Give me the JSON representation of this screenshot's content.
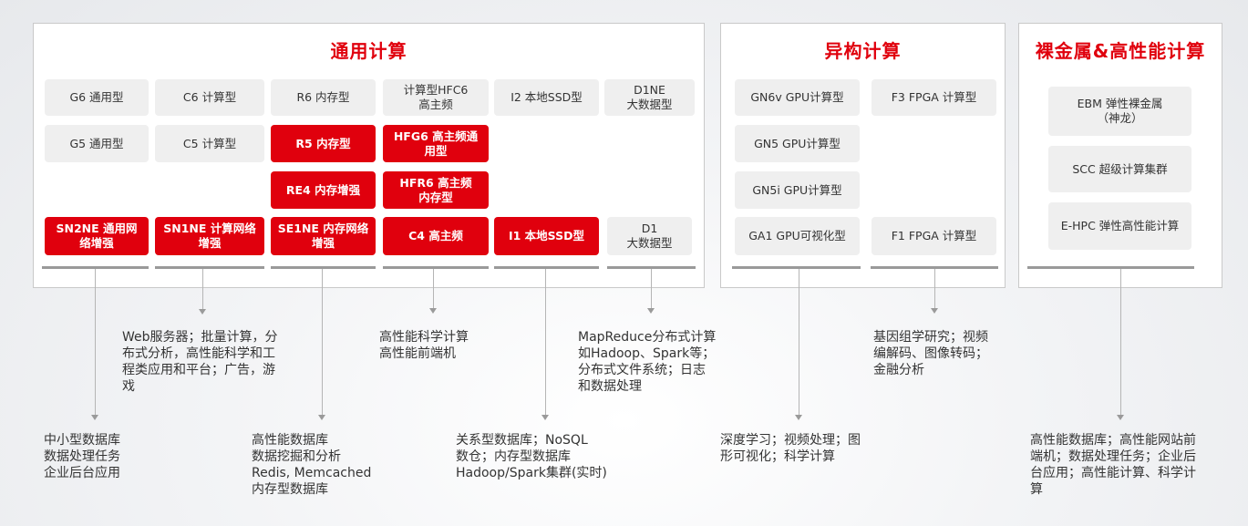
{
  "panels": {
    "general": {
      "title": "通用计算"
    },
    "hetero": {
      "title": "异构计算"
    },
    "baremetal": {
      "title": "裸金属&高性能计算"
    }
  },
  "boxes": {
    "g6": "G6 通用型",
    "c6": "C6 计算型",
    "r6": "R6 内存型",
    "hfc6": "计算型HFC6\n高主频",
    "i2": "I2 本地SSD型",
    "d1ne": "D1NE\n大数据型",
    "g5": "G5 通用型",
    "c5": "C5 计算型",
    "r5": "R5 内存型",
    "hfg6": "HFG6 高主频通\n用型",
    "re4": "RE4 内存增强",
    "hfr6": "HFR6 高主频\n内存型",
    "sn2ne": "SN2NE 通用网\n络增强",
    "sn1ne": "SN1NE 计算网络\n增强",
    "se1ne": "SE1NE 内存网络\n增强",
    "c4": "C4 高主频",
    "i1": "I1 本地SSD型",
    "d1": "D1\n大数据型",
    "gn6v": "GN6v GPU计算型",
    "f3": "F3 FPGA 计算型",
    "gn5": "GN5  GPU计算型",
    "gn5i": "GN5i GPU计算型",
    "ga1": "GA1 GPU可视化型",
    "f1": "F1 FPGA 计算型",
    "ebm": "EBM 弹性裸金属\n（神龙）",
    "scc": "SCC 超级计算集群",
    "ehpc": "E-HPC 弹性高性能计算"
  },
  "descriptions": {
    "web": "Web服务器；批量计算，分\n布式分析，高性能科学和工\n程类应用和平台；广告，游\n戏",
    "hpc": "高性能科学计算\n高性能前端机",
    "mapreduce": "MapReduce分布式计算\n如Hadoop、Spark等；\n分布式文件系统；日志\n和数据处理",
    "genomics": "基因组学研究；视频\n编解码、图像转码；\n金融分析",
    "smalldb": "中小型数据库\n数据处理任务\n企业后台应用",
    "hpdb": "高性能数据库\n数据挖掘和分析\nRedis, Memcached\n内存型数据库",
    "relational": "关系型数据库；NoSQL\n数仓；内存型数据库\nHadoop/Spark集群(实时)",
    "deeplearning": "深度学习；视频处理；图\n形可视化；科学计算",
    "hpcweb": "高性能数据库；高性能网站前\n端机；数据处理任务；企业后\n台应用；高性能计算、科学计\n算"
  },
  "colors": {
    "accent": "#e0000d",
    "gray_box": "#efefef",
    "connector": "#9a9a9a"
  }
}
